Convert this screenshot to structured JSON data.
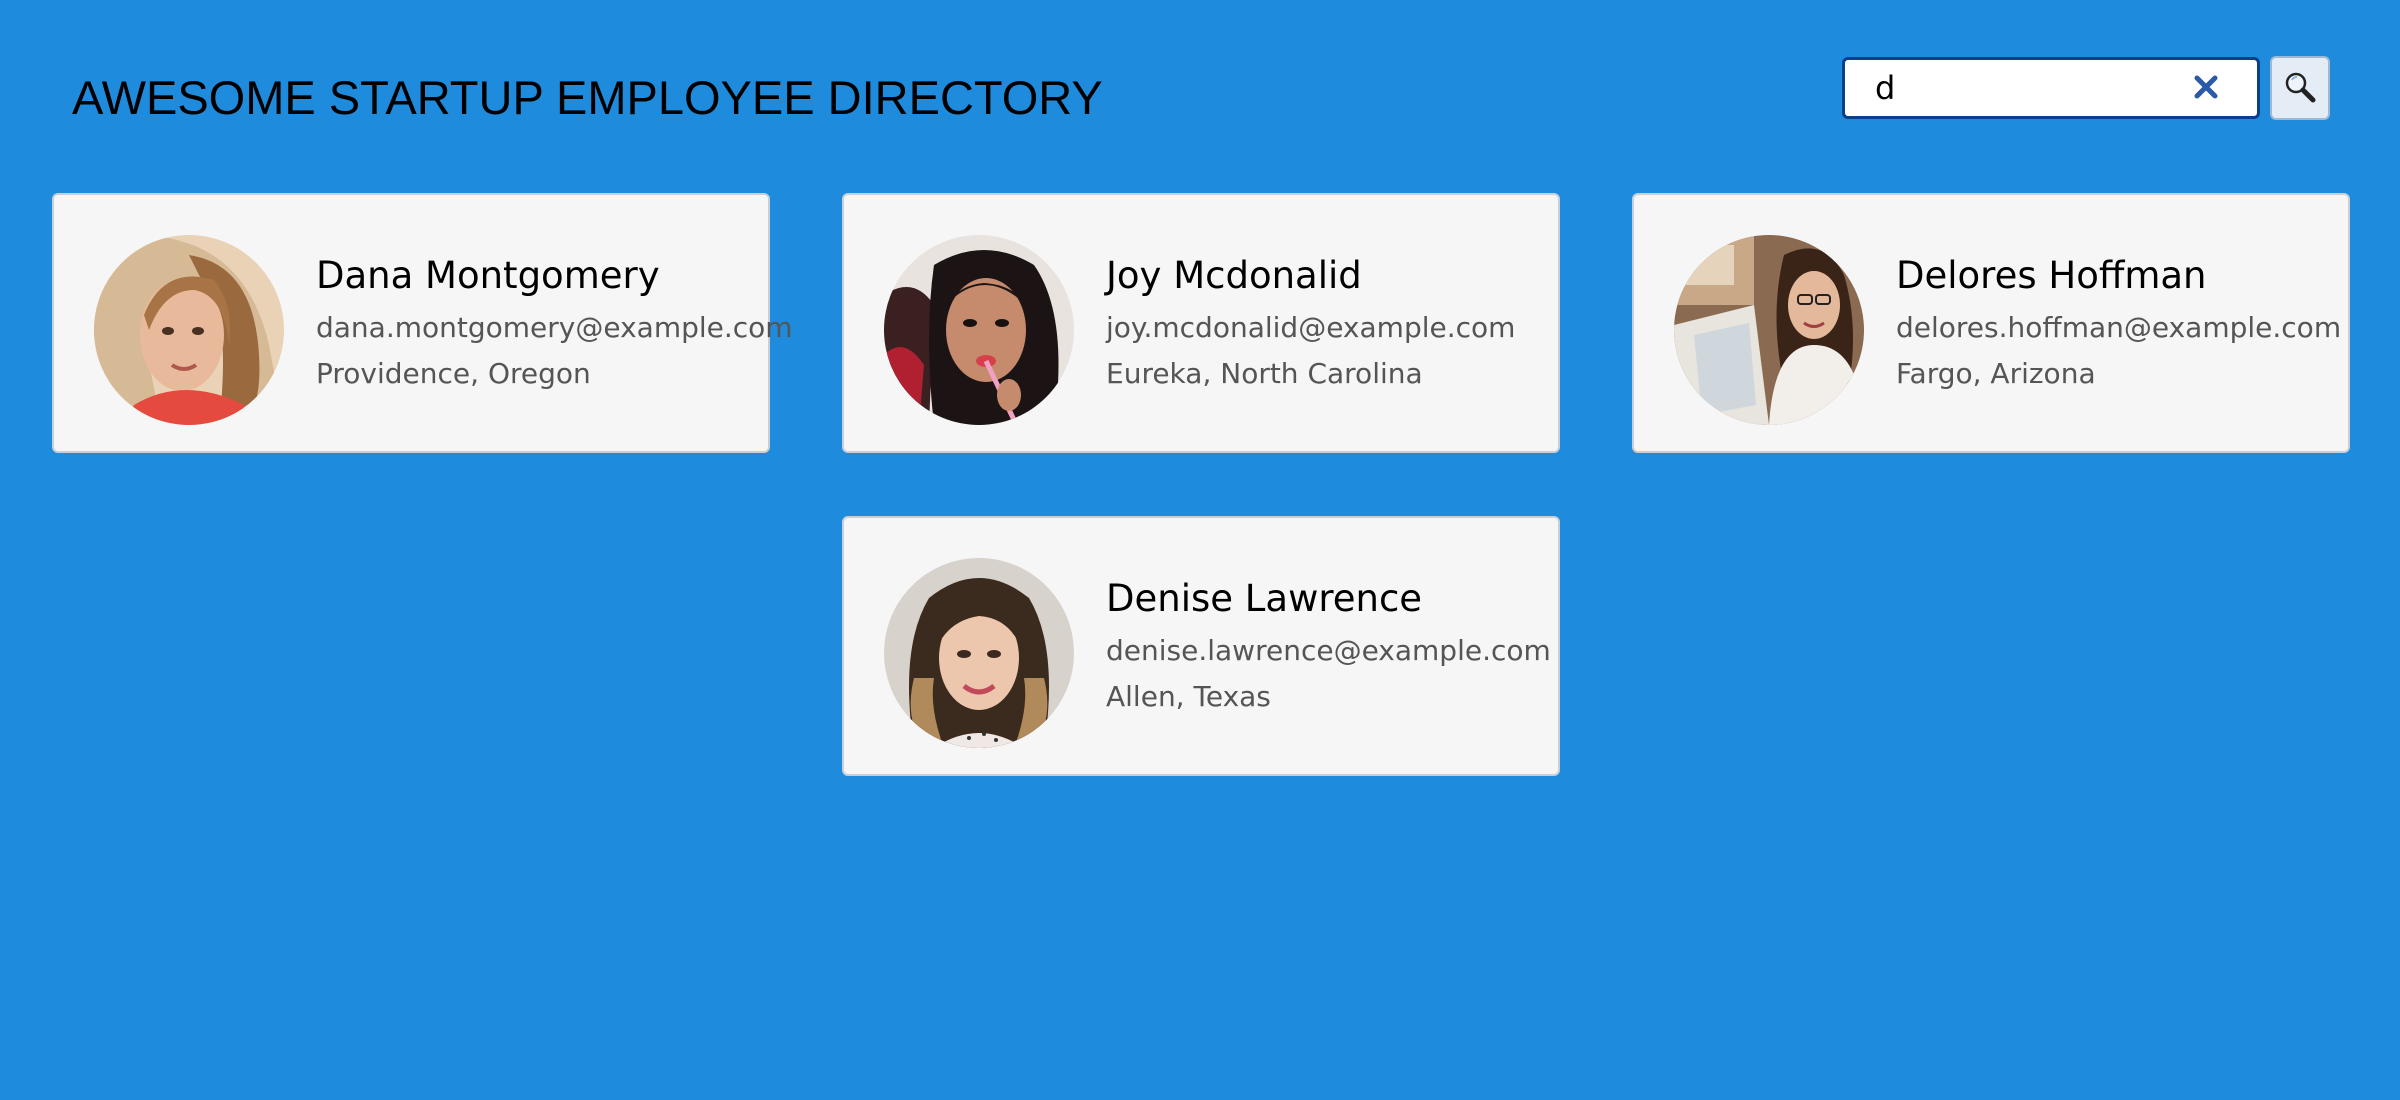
{
  "header": {
    "title": "AWESOME STARTUP EMPLOYEE DIRECTORY"
  },
  "search": {
    "value": "d",
    "clear_icon": "close-icon",
    "button_icon": "search-icon"
  },
  "employees": [
    {
      "name": "Dana Montgomery",
      "email": "dana.montgomery@example.com",
      "location": "Providence, Oregon"
    },
    {
      "name": "Joy Mcdonalid",
      "email": "joy.mcdonalid@example.com",
      "location": "Eureka, North Carolina"
    },
    {
      "name": "Delores Hoffman",
      "email": "delores.hoffman@example.com",
      "location": "Fargo, Arizona"
    },
    {
      "name": "Denise Lawrence",
      "email": "denise.lawrence@example.com",
      "location": "Allen, Texas"
    }
  ],
  "colors": {
    "background": "#1e8bdc",
    "card": "#f6f6f6",
    "clear_icon": "#2a5aa8"
  }
}
